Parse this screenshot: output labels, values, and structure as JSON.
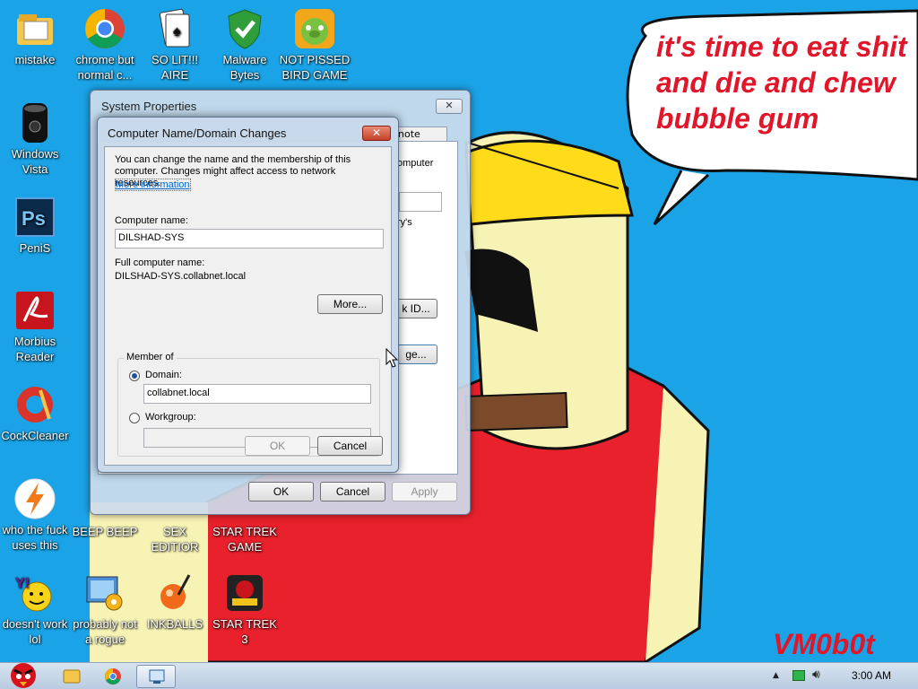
{
  "desktop": {
    "icons": [
      {
        "label": "mistake",
        "icon": "folder-icon"
      },
      {
        "label": "chrome but normal c...",
        "icon": "chrome-icon"
      },
      {
        "label": "SO LIT!!! AIRE",
        "icon": "solitaire-icon"
      },
      {
        "label": "Malware Bytes",
        "icon": "shield-icon"
      },
      {
        "label": "NOT PISSED BIRD GAME",
        "icon": "pig-icon"
      },
      {
        "label": "Windows Vista",
        "icon": "vista-icon"
      },
      {
        "label": "PeniS",
        "icon": "photoshop-icon"
      },
      {
        "label": "Morbius Reader",
        "icon": "pdf-icon"
      },
      {
        "label": "CockCleaner",
        "icon": "ccleaner-icon"
      },
      {
        "label": "who the fuck uses this",
        "icon": "thunder-icon"
      },
      {
        "label": "BEEP BEEP",
        "icon": "app-icon"
      },
      {
        "label": "SEX EDITIOR",
        "icon": "app-icon"
      },
      {
        "label": "STAR TREK GAME",
        "icon": "app-icon"
      },
      {
        "label": "doesn't work lol",
        "icon": "yahoo-icon"
      },
      {
        "label": "probably not a rogue",
        "icon": "gears-icon"
      },
      {
        "label": "INKBALLS",
        "icon": "inkball-icon"
      },
      {
        "label": "STAR TREK 3",
        "icon": "starwars-icon"
      }
    ],
    "speech_bubble": "it's time to eat shit and die and chew bubble gum",
    "watermark": "VM0b0t"
  },
  "system_properties": {
    "title": "System Properties",
    "close": "✕",
    "tab_partial": "note",
    "bg_text": [
      "omputer",
      "ry's"
    ],
    "bg_buttons": [
      "k ID...",
      "ge..."
    ],
    "ok": "OK",
    "cancel": "Cancel",
    "apply": "Apply"
  },
  "computer_name_dialog": {
    "title": "Computer Name/Domain Changes",
    "close": "✕",
    "description": "You can change the name and the membership of this computer. Changes might affect access to network resources.",
    "more_info_link": "More information",
    "computer_name_label": "Computer name:",
    "computer_name_value": "DILSHAD-SYS",
    "full_name_label": "Full computer name:",
    "full_name_value": "DILSHAD-SYS.collabnet.local",
    "more_button": "More...",
    "member_of_label": "Member of",
    "domain_label": "Domain:",
    "domain_value": "collabnet.local",
    "workgroup_label": "Workgroup:",
    "workgroup_value": "",
    "ok": "OK",
    "cancel": "Cancel"
  },
  "taskbar": {
    "clock": "3:00 AM",
    "items": [
      "start-angry-bird-icon",
      "explorer-icon",
      "chrome-icon",
      "system-properties-icon"
    ],
    "tray": [
      "show-hidden-icon",
      "network-icon",
      "volume-icon"
    ]
  },
  "colors": {
    "sky": "#1aa3e6",
    "accent_red": "#e0162a",
    "dialog_close": "#c3432a"
  }
}
